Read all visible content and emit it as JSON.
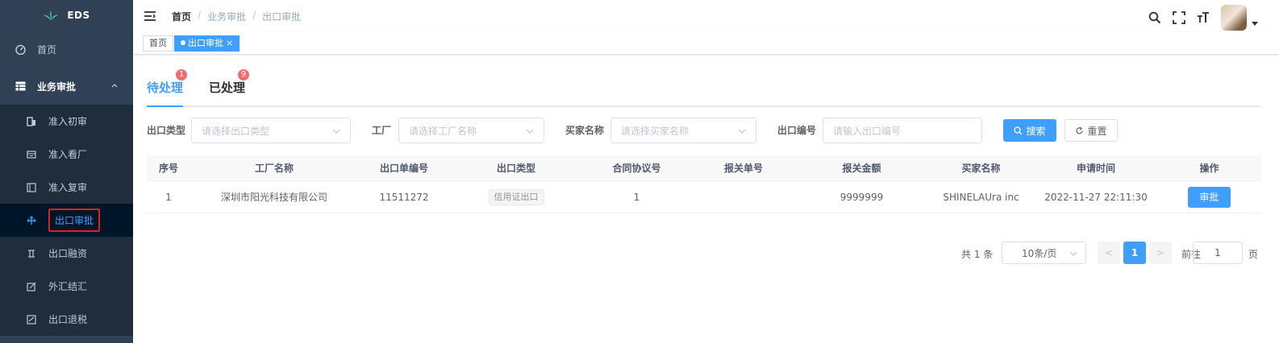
{
  "app": {
    "title": "EDS"
  },
  "sidebar": {
    "home": "首页",
    "group": "业务审批",
    "items": [
      {
        "label": "准入初审",
        "icon": "document-icon"
      },
      {
        "label": "准入看厂",
        "icon": "factory-icon"
      },
      {
        "label": "准入复审",
        "icon": "book-icon"
      },
      {
        "label": "出口审批",
        "icon": "arrows-icon"
      },
      {
        "label": "出口融资",
        "icon": "finance-icon"
      },
      {
        "label": "外汇结汇",
        "icon": "edit-icon"
      },
      {
        "label": "出口退税",
        "icon": "form-icon"
      }
    ]
  },
  "header": {
    "breadcrumb": [
      "首页",
      "业务审批",
      "出口审批"
    ],
    "separator": "/"
  },
  "tagsview": {
    "home": "首页",
    "current": "出口审批",
    "close": "×"
  },
  "tabs": [
    {
      "label": "待处理",
      "badge": "1"
    },
    {
      "label": "已处理",
      "badge": "9"
    }
  ],
  "filters": [
    {
      "label": "出口类型",
      "placeholder": "请选择出口类型"
    },
    {
      "label": "工厂",
      "placeholder": "请选择工厂名称"
    },
    {
      "label": "买家名称",
      "placeholder": "请选择买家名称"
    },
    {
      "label": "出口编号",
      "placeholder": "请输入出口编号"
    }
  ],
  "buttons": {
    "search": "搜索",
    "reset": "重置"
  },
  "table": {
    "headers": [
      "序号",
      "工厂名称",
      "出口单编号",
      "出口类型",
      "合同协议号",
      "报关单号",
      "报关金额",
      "买家名称",
      "申请时间",
      "操作"
    ],
    "rows": [
      {
        "index": "1",
        "factory": "深圳市阳光科技有限公司",
        "export_no": "11511272",
        "export_type": "信用证出口",
        "contract_no": "1",
        "customs_no": "",
        "amount": "9999999",
        "buyer": "SHINELAUra inc",
        "time": "2022-11-27 22:11:30",
        "action": "审批"
      }
    ]
  },
  "pagination": {
    "total": "共 1 条",
    "page_size": "10条/页",
    "prev": "<",
    "current": "1",
    "next": ">",
    "goto": "前往",
    "goto_value": "1",
    "page_unit": "页"
  },
  "colors": {
    "primary": "#409eff",
    "sidebar": "#304156",
    "badge": "#f56c6c",
    "highlight": "#e02020"
  }
}
